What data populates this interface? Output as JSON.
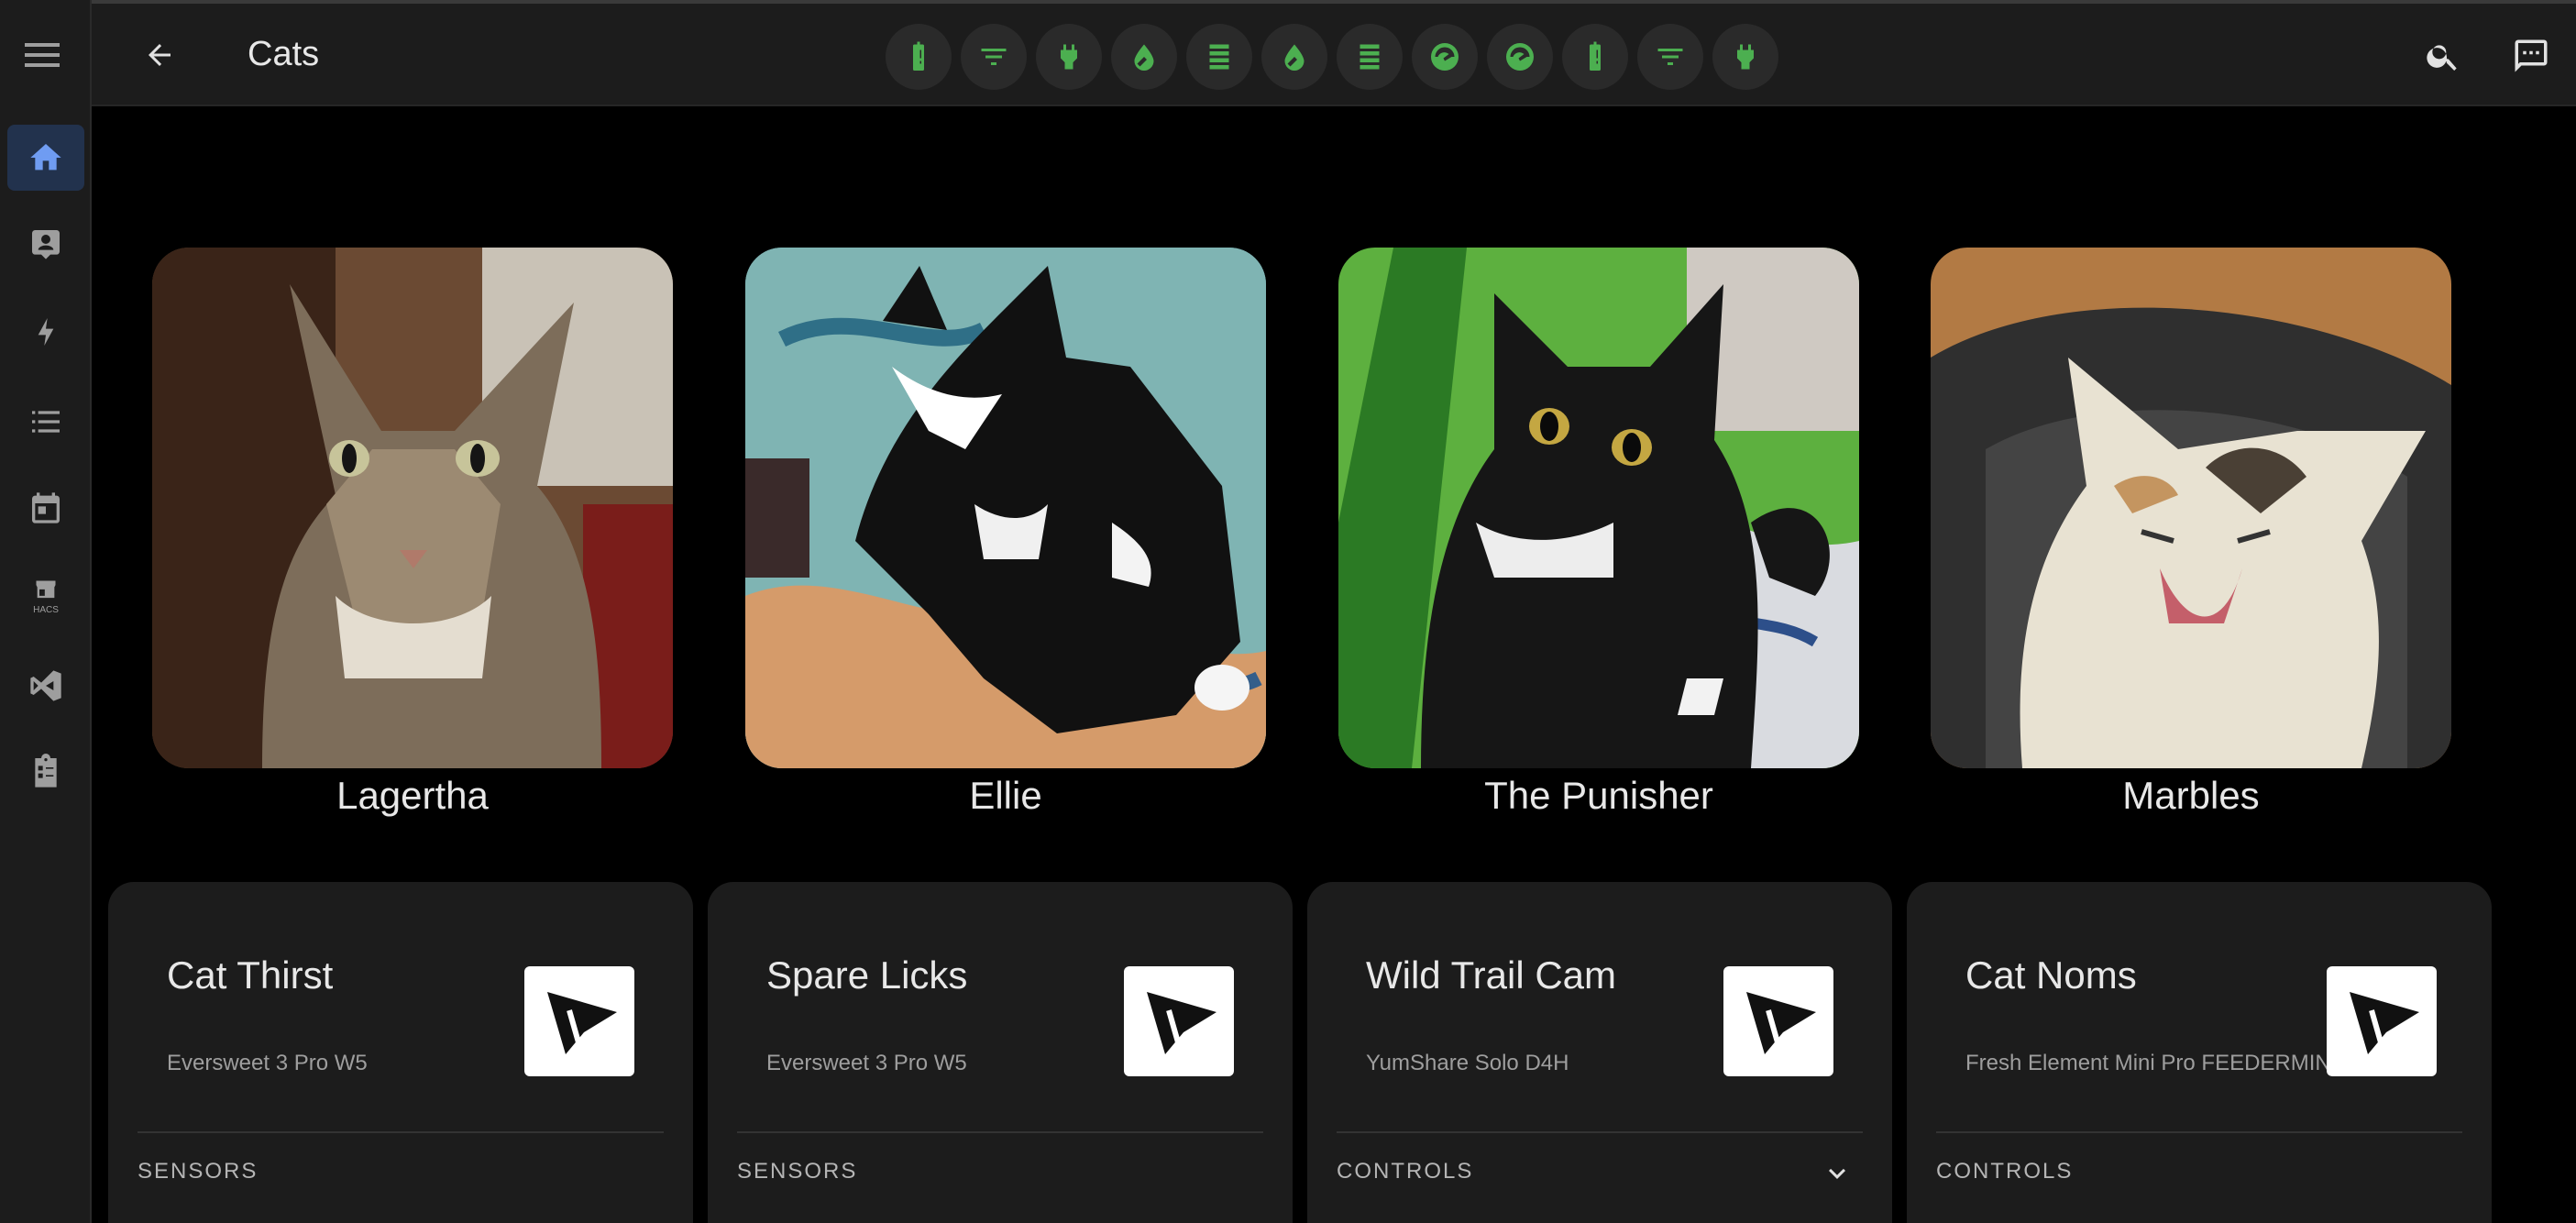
{
  "header": {
    "title": "Cats",
    "badges": [
      "battery-alert-icon",
      "filter-icon",
      "power-plug-icon",
      "water-icon",
      "filter-layers-icon",
      "water-icon",
      "filter-layers-icon",
      "gauge-icon",
      "gauge-icon",
      "battery-alert-icon",
      "filter-icon",
      "power-plug-icon"
    ]
  },
  "sidebar": {
    "items": [
      "home",
      "account-box",
      "energy",
      "todo",
      "calendar",
      "hacs",
      "vscode",
      "clipboard"
    ],
    "hacs_label": "HACS"
  },
  "cats": [
    {
      "name": "Lagertha"
    },
    {
      "name": "Ellie"
    },
    {
      "name": "The Punisher"
    },
    {
      "name": "Marbles"
    }
  ],
  "cards": [
    {
      "title": "Cat Thirst",
      "subtitle": "Eversweet 3 Pro W5",
      "section": "SENSORS"
    },
    {
      "title": "Spare Licks",
      "subtitle": "Eversweet 3 Pro W5",
      "section": "SENSORS"
    },
    {
      "title": "Wild Trail Cam",
      "subtitle": "YumShare Solo D4H",
      "section": "CONTROLS"
    },
    {
      "title": "Cat Noms",
      "subtitle": "Fresh Element Mini Pro FEEDERMINI",
      "section": "CONTROLS"
    }
  ],
  "colors": {
    "accent": "#6f9cf2",
    "badge_icon": "#4caf50",
    "card_bg": "#1c1c1c"
  }
}
